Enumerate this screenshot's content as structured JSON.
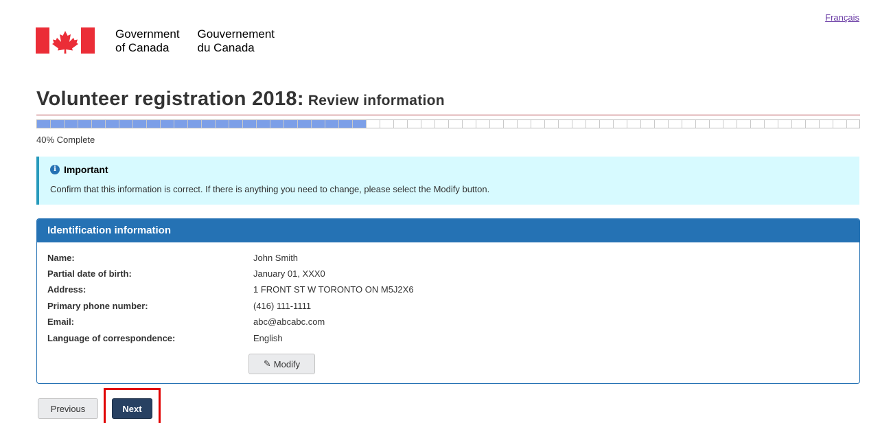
{
  "header": {
    "language_link": "Français",
    "gov_en_line1": "Government",
    "gov_en_line2": "of Canada",
    "gov_fr_line1": "Gouvernement",
    "gov_fr_line2": "du Canada"
  },
  "page": {
    "title": "Volunteer registration 2018:",
    "subtitle": "Review information"
  },
  "progress": {
    "percent": 40,
    "label": "40% Complete"
  },
  "alert": {
    "title": "Important",
    "text": "Confirm that this information is correct. If there is anything you need to change, please select the Modify button."
  },
  "panel": {
    "heading": "Identification information",
    "rows": [
      {
        "label": "Name:",
        "value": "John Smith"
      },
      {
        "label": "Partial date of birth:",
        "value": "January 01, XXX0"
      },
      {
        "label": "Address:",
        "value": "1 FRONT ST W TORONTO ON M5J2X6"
      },
      {
        "label": "Primary phone number:",
        "value": "(416) 111-1111"
      },
      {
        "label": "Email:",
        "value": "abc@abcabc.com"
      },
      {
        "label": "Language of correspondence:",
        "value": "English"
      }
    ],
    "modify_label": "Modify"
  },
  "nav": {
    "previous_label": "Previous",
    "next_label": "Next"
  },
  "colors": {
    "flag_red": "#eb2d37",
    "title_rule": "#af3c43",
    "progress_fill": "#7c9fe8",
    "alert_bg": "#d7faff",
    "panel_blue": "#2572b4",
    "next_button": "#284162",
    "highlight": "#e00000"
  },
  "icons": {
    "flag": "canada-flag-icon",
    "info": "info-icon",
    "modify": "edit-icon"
  }
}
